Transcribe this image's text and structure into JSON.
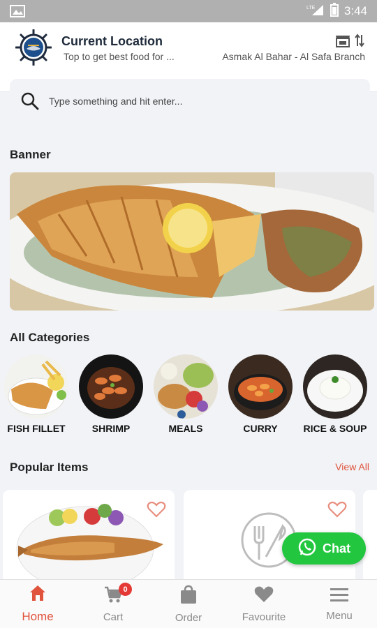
{
  "status_bar": {
    "time": "3:44",
    "network": "LTE"
  },
  "header": {
    "location_title": "Current Location",
    "location_subtitle": "Top to get best food for ...",
    "branch_name": "Asmak Al Bahar - Al Safa Branch"
  },
  "search": {
    "placeholder": "Type something and hit enter..."
  },
  "banner_section": {
    "title": "Banner"
  },
  "categories_section": {
    "title": "All Categories",
    "items": [
      {
        "label": "FISH FILLET"
      },
      {
        "label": "SHRIMP"
      },
      {
        "label": "MEALS"
      },
      {
        "label": "CURRY"
      },
      {
        "label": "RICE & SOUP"
      }
    ]
  },
  "popular_section": {
    "title": "Popular Items",
    "view_all": "View All"
  },
  "chat": {
    "label": "Chat"
  },
  "bottom_nav": {
    "items": [
      {
        "label": "Home",
        "icon": "home-icon",
        "active": true
      },
      {
        "label": "Cart",
        "icon": "cart-icon",
        "badge": "0"
      },
      {
        "label": "Order",
        "icon": "bag-icon"
      },
      {
        "label": "Favourite",
        "icon": "heart-icon"
      },
      {
        "label": "Menu",
        "icon": "menu-icon"
      }
    ]
  },
  "colors": {
    "accent": "#e0533c",
    "chat_green": "#22c73f",
    "badge_red": "#e53935"
  }
}
